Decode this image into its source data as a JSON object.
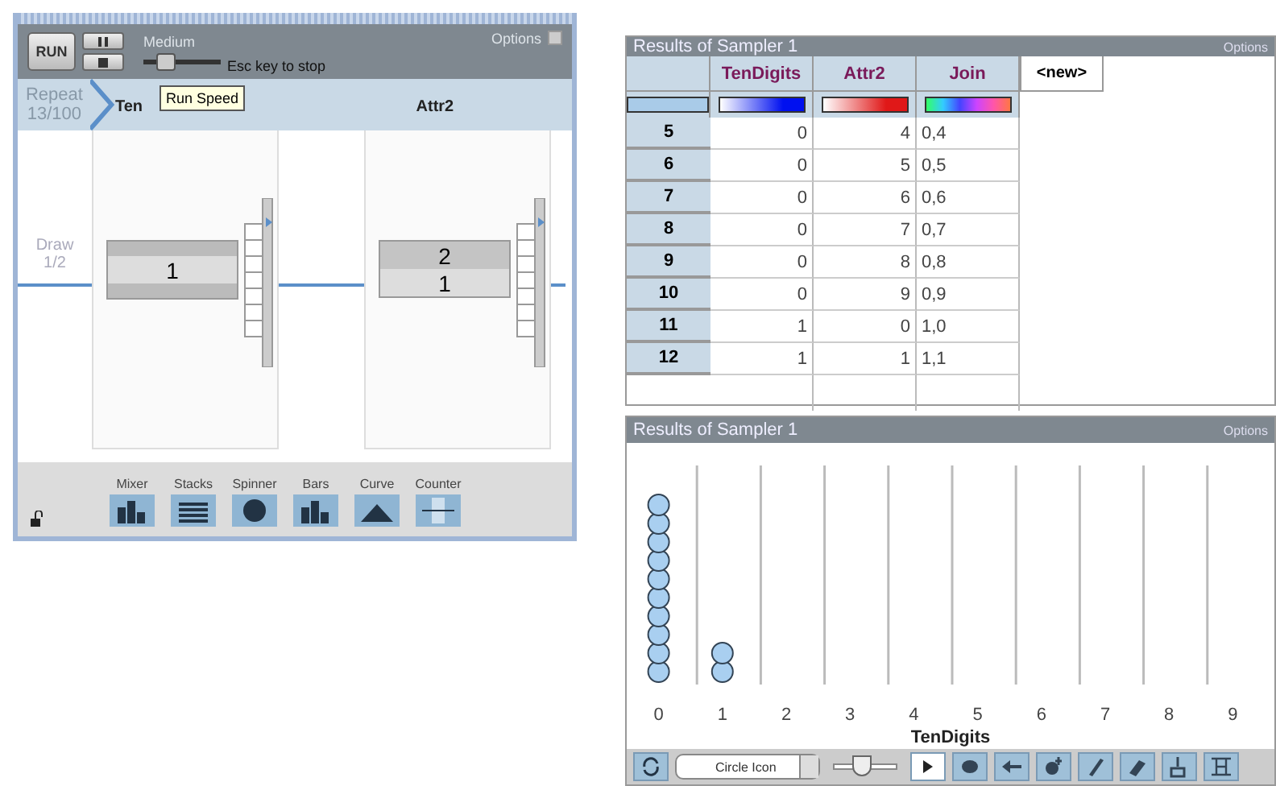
{
  "simulator": {
    "run_button": "RUN",
    "speed_label": "Medium",
    "speed": {
      "level": 0.3
    },
    "hint": "Esc key to stop",
    "options": "Options",
    "tooltip": "Run Speed",
    "repeat": {
      "label": "Repeat",
      "count": "13/100"
    },
    "draw": {
      "label": "Draw",
      "count": "1/2"
    },
    "devices": [
      {
        "header": "Ten",
        "reel": [
          "1"
        ],
        "cut_edges": true
      },
      {
        "header": "Attr2",
        "reel": [
          "2",
          "1"
        ],
        "cut_edges": false
      }
    ],
    "locked": false,
    "palette": [
      {
        "label": "Mixer",
        "kind": "mixer"
      },
      {
        "label": "Stacks",
        "kind": "stacks"
      },
      {
        "label": "Spinner",
        "kind": "spinner"
      },
      {
        "label": "Bars",
        "kind": "bars"
      },
      {
        "label": "Curve",
        "kind": "curve"
      },
      {
        "label": "Counter",
        "kind": "counter"
      }
    ]
  },
  "table": {
    "title": "Results of Sampler 1",
    "options": "Options",
    "columns": [
      {
        "name": "TenDigits",
        "kind": "gradient",
        "color": "#0010f0"
      },
      {
        "name": "Attr2",
        "kind": "gradient",
        "color": "#e01818"
      },
      {
        "name": "Join",
        "kind": "spectrum"
      }
    ],
    "new_column": "<new>",
    "rows": [
      {
        "index": "5",
        "cells": [
          "0",
          "4",
          "0,4"
        ]
      },
      {
        "index": "6",
        "cells": [
          "0",
          "5",
          "0,5"
        ]
      },
      {
        "index": "7",
        "cells": [
          "0",
          "6",
          "0,6"
        ]
      },
      {
        "index": "8",
        "cells": [
          "0",
          "7",
          "0,7"
        ]
      },
      {
        "index": "9",
        "cells": [
          "0",
          "8",
          "0,8"
        ]
      },
      {
        "index": "10",
        "cells": [
          "0",
          "9",
          "0,9"
        ]
      },
      {
        "index": "11",
        "cells": [
          "1",
          "0",
          "1,0"
        ]
      },
      {
        "index": "12",
        "cells": [
          "1",
          "1",
          "1,1"
        ]
      }
    ]
  },
  "plot": {
    "title": "Results of Sampler 1",
    "options": "Options",
    "axis_title": "TenDigits",
    "stacks": [
      {
        "label": "0"
      },
      {
        "label": "1"
      },
      {
        "label": "2"
      },
      {
        "label": "3"
      },
      {
        "label": "4"
      },
      {
        "label": "5"
      },
      {
        "label": "6"
      },
      {
        "label": "7"
      },
      {
        "label": "8"
      },
      {
        "label": "9"
      }
    ],
    "icon_select": "Circle Icon",
    "size": {
      "level": 0.45
    },
    "tools": [
      {
        "kind": "pointer",
        "selected": true
      },
      {
        "kind": "hand",
        "selected": false
      },
      {
        "kind": "arrow",
        "selected": false
      },
      {
        "kind": "add",
        "selected": false
      },
      {
        "kind": "pencil",
        "selected": false
      },
      {
        "kind": "eraser",
        "selected": false
      },
      {
        "kind": "brush",
        "selected": false
      },
      {
        "kind": "text",
        "selected": false
      }
    ]
  }
}
